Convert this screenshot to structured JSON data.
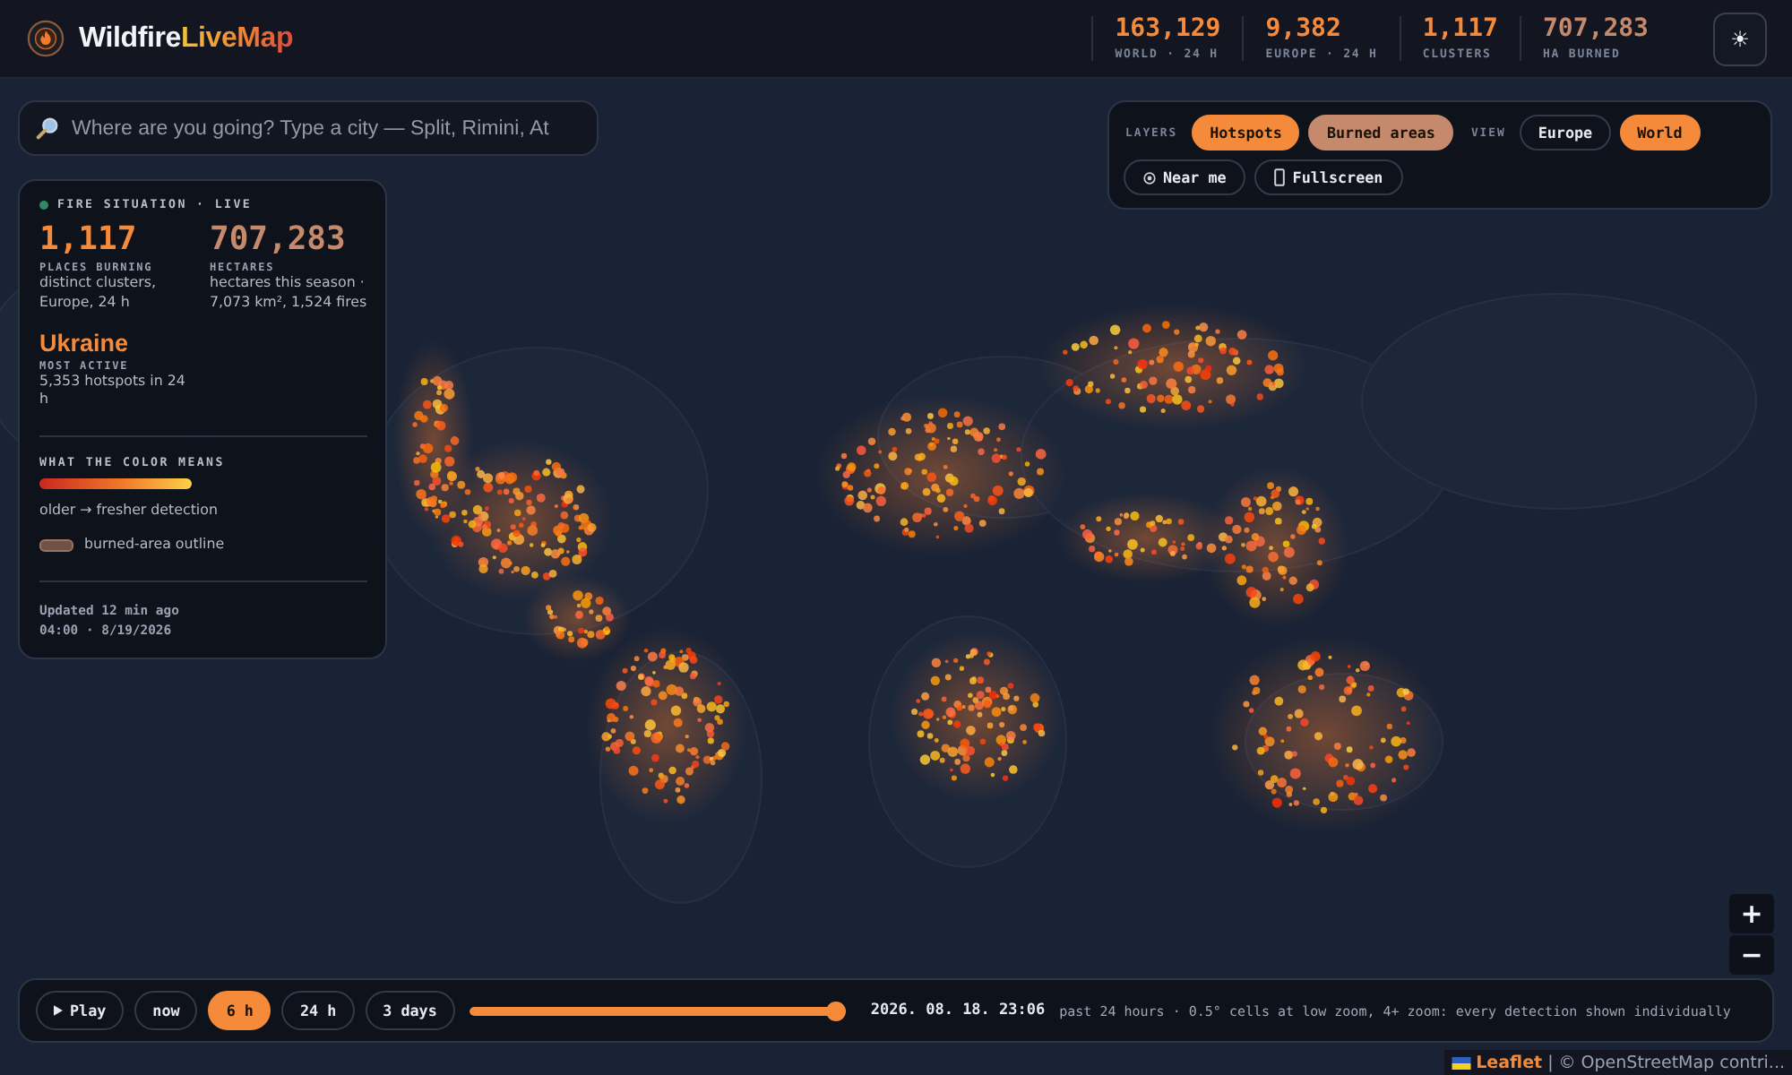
{
  "header": {
    "title": "Wildfire",
    "title_accent": "LiveMap",
    "stats": [
      {
        "value": "163,129",
        "label": "WORLD · 24 H",
        "kind": "hotspots"
      },
      {
        "value": "9,382",
        "label": "EUROPE · 24 H",
        "kind": "hotspots"
      },
      {
        "value": "1,117",
        "label": "CLUSTERS",
        "kind": "hotspots"
      },
      {
        "value": "707,283",
        "label": "HA BURNED",
        "kind": "burned"
      }
    ],
    "theme_toggle": "☀"
  },
  "search": {
    "placeholder": "Where are you going? Type a city — Split, Rimini, At"
  },
  "situation": {
    "heading": "FIRE SITUATION · LIVE",
    "metrics": [
      {
        "value": "1,117",
        "label": "PLACES BURNING",
        "note": "distinct clusters, Europe, 24 h",
        "kind": "hotspots"
      },
      {
        "value": "707,283",
        "label": "HECTARES",
        "note": "hectares this season · 7,073 km², 1,524 fires",
        "kind": "burned"
      }
    ],
    "most_active": {
      "value": "Ukraine",
      "label": "MOST ACTIVE",
      "note": "5,353 hotspots in 24 h"
    },
    "legend": {
      "heading": "WHAT THE COLOR MEANS",
      "gradient_caption": "older → fresher detection",
      "outline_caption": "burned-area outline"
    },
    "updated": "Updated 12 min ago",
    "timestamp": "04:00 · 8/19/2026"
  },
  "map_controls": {
    "layers_label": "LAYERS",
    "layers": [
      {
        "label": "Hotspots",
        "on": true,
        "kind": "hotspots"
      },
      {
        "label": "Burned areas",
        "on": true,
        "kind": "burned"
      }
    ],
    "view_label": "VIEW",
    "views": [
      {
        "label": "Europe",
        "selected": false
      },
      {
        "label": "World",
        "selected": true
      }
    ],
    "actions": [
      {
        "label": "Near me",
        "kind": "locate"
      },
      {
        "label": "Fullscreen",
        "kind": "fullscreen"
      }
    ]
  },
  "zoom": {
    "in": "+",
    "out": "−"
  },
  "timeline": {
    "play": "Play",
    "ranges": [
      {
        "label": "now",
        "selected": false
      },
      {
        "label": "6 h",
        "selected": true
      },
      {
        "label": "24 h",
        "selected": false
      },
      {
        "label": "3 days",
        "selected": false
      }
    ],
    "slider": {
      "level": 1
    },
    "timestamp": "2026. 08. 18. 23:06",
    "caption": "past 24 hours · 0.5° cells at low zoom, 4+ zoom: every detection shown individually"
  },
  "attribution": {
    "link": "Leaflet",
    "text": "| © OpenStreetMap contri..."
  }
}
